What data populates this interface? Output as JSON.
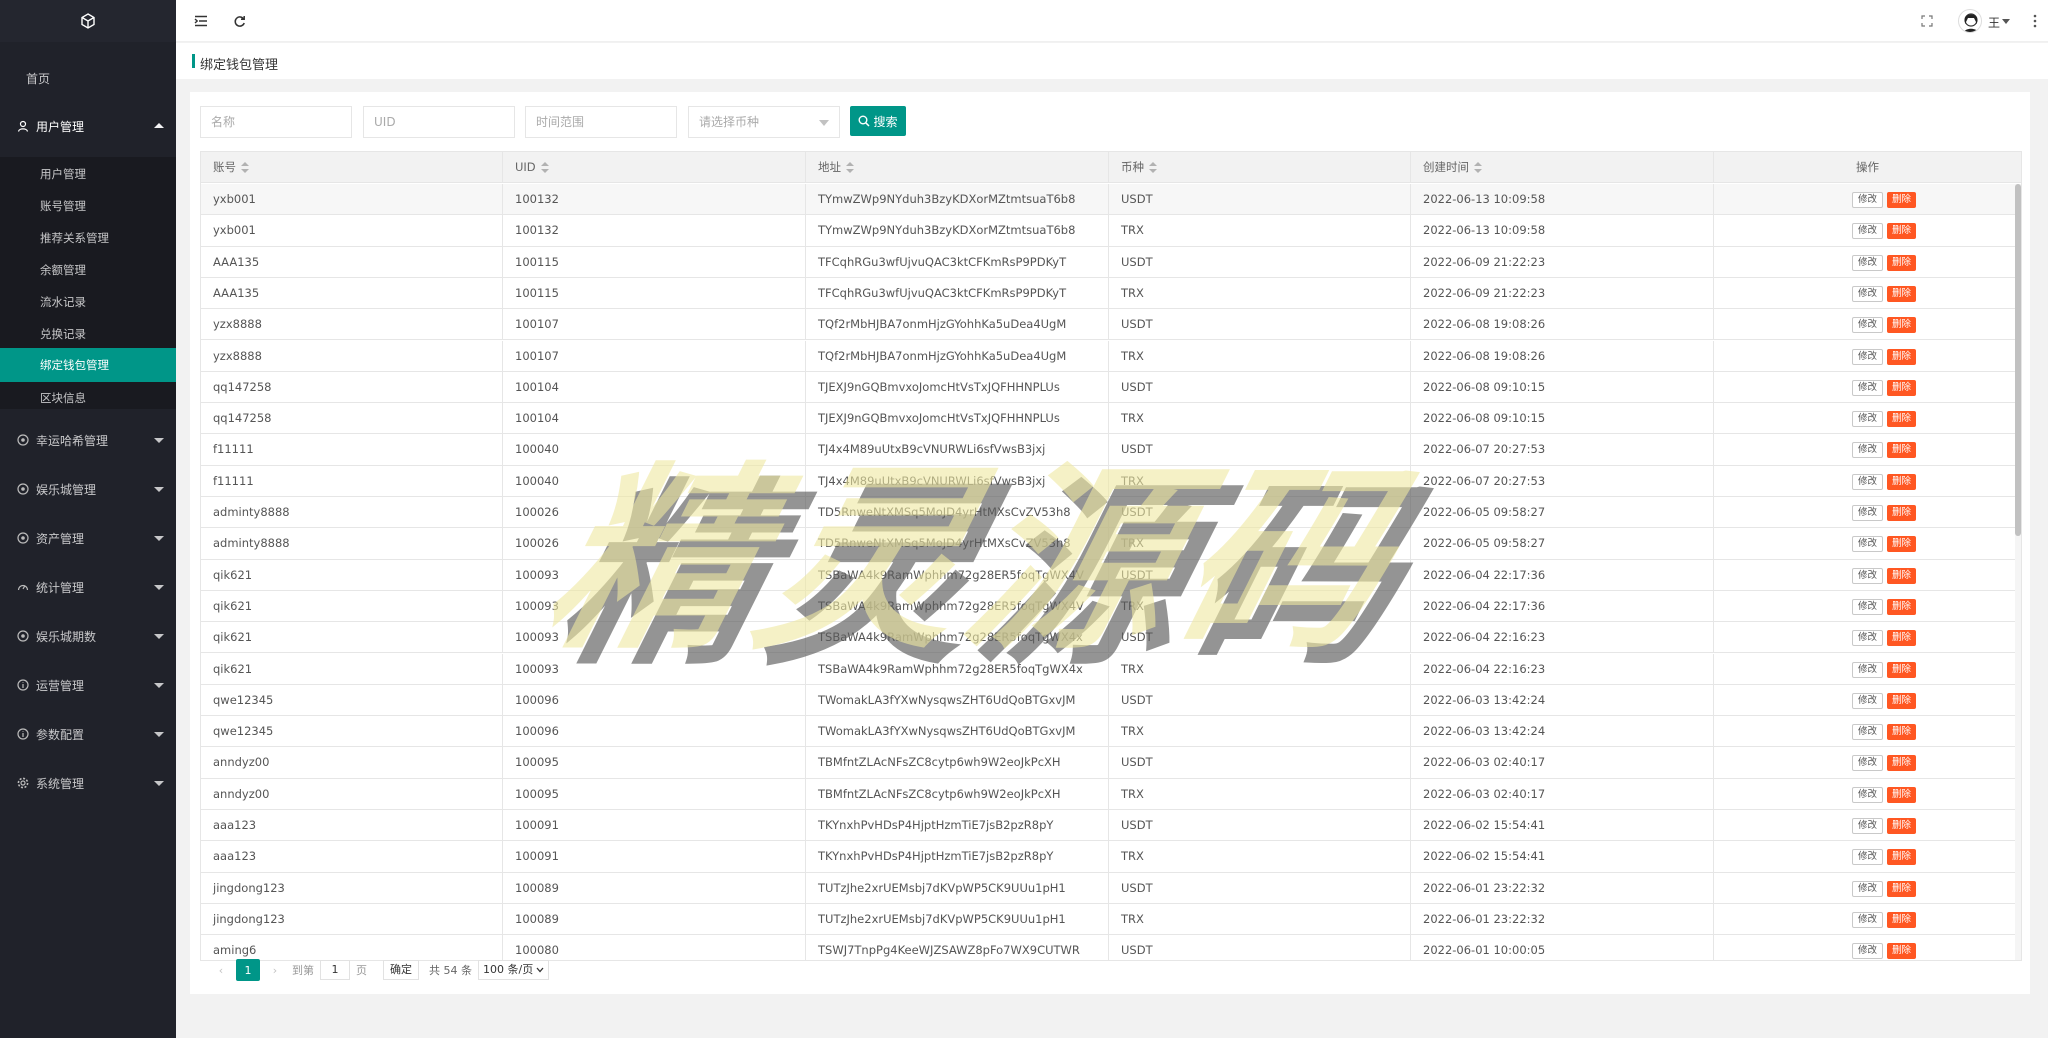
{
  "sidebar": {
    "home": "首页",
    "user_mgmt": "用户管理",
    "sub_items": [
      "用户管理",
      "账号管理",
      "推荐关系管理",
      "余额管理",
      "流水记录",
      "兑换记录",
      "绑定钱包管理",
      "区块信息"
    ],
    "active_sub": "绑定钱包管理",
    "groups": [
      "幸运哈希管理",
      "娱乐城管理",
      "资产管理",
      "统计管理",
      "娱乐城期数",
      "运营管理",
      "参数配置",
      "系统管理"
    ]
  },
  "header": {
    "user_name": "王"
  },
  "breadcrumb": {
    "title": "绑定钱包管理"
  },
  "search": {
    "name_placeholder": "名称",
    "uid_placeholder": "UID",
    "time_placeholder": "时间范围",
    "coin_placeholder": "请选择币种",
    "button": "搜索"
  },
  "table": {
    "headers": [
      "账号",
      "UID",
      "地址",
      "币种",
      "创建时间",
      "操作"
    ],
    "edit_label": "修改",
    "delete_label": "删除",
    "rows": [
      [
        "yxb001",
        "100132",
        "TYmwZWp9NYduh3BzyKDXorMZtmtsuaT6b8",
        "USDT",
        "2022-06-13 10:09:58"
      ],
      [
        "yxb001",
        "100132",
        "TYmwZWp9NYduh3BzyKDXorMZtmtsuaT6b8",
        "TRX",
        "2022-06-13 10:09:58"
      ],
      [
        "AAA135",
        "100115",
        "TFCqhRGu3wfUjvuQAC3ktCFKmRsP9PDKyT",
        "USDT",
        "2022-06-09 21:22:23"
      ],
      [
        "AAA135",
        "100115",
        "TFCqhRGu3wfUjvuQAC3ktCFKmRsP9PDKyT",
        "TRX",
        "2022-06-09 21:22:23"
      ],
      [
        "yzx8888",
        "100107",
        "TQf2rMbHJBA7onmHjzGYohhKa5uDea4UgM",
        "USDT",
        "2022-06-08 19:08:26"
      ],
      [
        "yzx8888",
        "100107",
        "TQf2rMbHJBA7onmHjzGYohhKa5uDea4UgM",
        "TRX",
        "2022-06-08 19:08:26"
      ],
      [
        "qq147258",
        "100104",
        "TJEXJ9nGQBmvxoJomcHtVsTxJQFHHNPLUs",
        "USDT",
        "2022-06-08 09:10:15"
      ],
      [
        "qq147258",
        "100104",
        "TJEXJ9nGQBmvxoJomcHtVsTxJQFHHNPLUs",
        "TRX",
        "2022-06-08 09:10:15"
      ],
      [
        "f11111",
        "100040",
        "TJ4x4M89uUtxB9cVNURWLi6sfVwsB3jxj",
        "USDT",
        "2022-06-07 20:27:53"
      ],
      [
        "f11111",
        "100040",
        "TJ4x4M89uUtxB9cVNURWLi6sfVwsB3jxj",
        "TRX",
        "2022-06-07 20:27:53"
      ],
      [
        "adminty8888",
        "100026",
        "TD5RnweNtXMSq5MoJD4yrHtMXsCvZV53h8",
        "USDT",
        "2022-06-05 09:58:27"
      ],
      [
        "adminty8888",
        "100026",
        "TD5RnweNtXMSq5MoJD4yrHtMXsCvZV53h8",
        "TRX",
        "2022-06-05 09:58:27"
      ],
      [
        "qik621",
        "100093",
        "TSBaWA4k9RamWphhm72g28ER5foqTgWX4V",
        "USDT",
        "2022-06-04 22:17:36"
      ],
      [
        "qik621",
        "100093",
        "TSBaWA4k9RamWphhm72g28ER5foqTgWX4V",
        "TRX",
        "2022-06-04 22:17:36"
      ],
      [
        "qik621",
        "100093",
        "TSBaWA4k9RamWphhm72g28ER5foqTgWX4x",
        "USDT",
        "2022-06-04 22:16:23"
      ],
      [
        "qik621",
        "100093",
        "TSBaWA4k9RamWphhm72g28ER5foqTgWX4x",
        "TRX",
        "2022-06-04 22:16:23"
      ],
      [
        "qwe12345",
        "100096",
        "TWomakLA3fYXwNysqwsZHT6UdQoBTGxvJM",
        "USDT",
        "2022-06-03 13:42:24"
      ],
      [
        "qwe12345",
        "100096",
        "TWomakLA3fYXwNysqwsZHT6UdQoBTGxvJM",
        "TRX",
        "2022-06-03 13:42:24"
      ],
      [
        "anndyz00",
        "100095",
        "TBMfntZLAcNFsZC8cytp6wh9W2eoJkPcXH",
        "USDT",
        "2022-06-03 02:40:17"
      ],
      [
        "anndyz00",
        "100095",
        "TBMfntZLAcNFsZC8cytp6wh9W2eoJkPcXH",
        "TRX",
        "2022-06-03 02:40:17"
      ],
      [
        "aaa123",
        "100091",
        "TKYnxhPvHDsP4HjptHzmTiE7jsB2pzR8pY",
        "USDT",
        "2022-06-02 15:54:41"
      ],
      [
        "aaa123",
        "100091",
        "TKYnxhPvHDsP4HjptHzmTiE7jsB2pzR8pY",
        "TRX",
        "2022-06-02 15:54:41"
      ],
      [
        "jingdong123",
        "100089",
        "TUTzJhe2xrUEMsbj7dKVpWP5CK9UUu1pH1",
        "USDT",
        "2022-06-01 23:22:32"
      ],
      [
        "jingdong123",
        "100089",
        "TUTzJhe2xrUEMsbj7dKVpWP5CK9UUu1pH1",
        "TRX",
        "2022-06-01 23:22:32"
      ],
      [
        "aming6",
        "100080",
        "TSWJ7TnpPg4KeeWJZSAWZ8pFo7WX9CUTWR",
        "USDT",
        "2022-06-01 10:00:05"
      ]
    ]
  },
  "pagination": {
    "current": "1",
    "goto_label": "到第",
    "goto_value": "1",
    "page_unit": "页",
    "confirm": "确定",
    "total": "共 54 条",
    "page_size": "100 条/页"
  },
  "watermark": {
    "text": "精灵源码"
  },
  "colors": {
    "accent": "#009688",
    "sidebar": "#20222a",
    "danger": "#ff5722"
  }
}
